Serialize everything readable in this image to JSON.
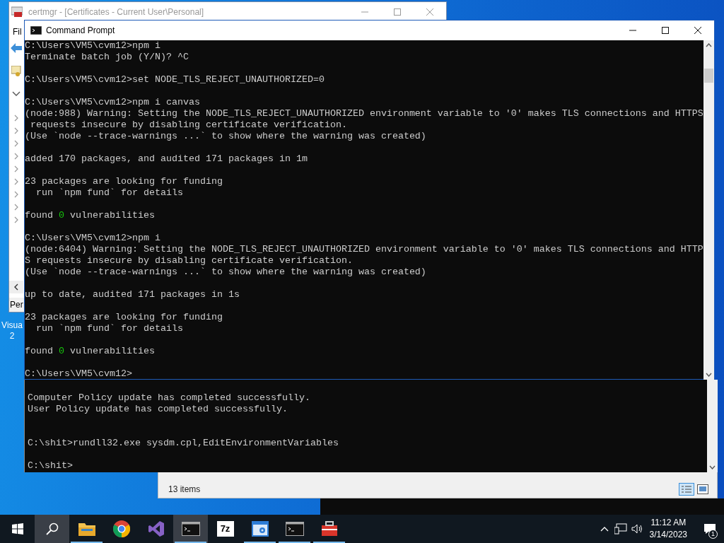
{
  "desktop": {
    "icon_label": "Visua\n2"
  },
  "certmgr": {
    "title": "certmgr - [Certificates - Current User\\Personal]",
    "menu_label": "Fil",
    "tab_label": "Per",
    "tree_nodes": [
      {
        "expanded": true
      },
      {
        "expanded": false
      },
      {
        "expanded": false
      },
      {
        "expanded": false
      },
      {
        "expanded": false
      },
      {
        "expanded": false
      },
      {
        "expanded": false
      },
      {
        "expanded": false
      },
      {
        "expanded": false
      },
      {
        "expanded": false
      }
    ]
  },
  "explorer": {
    "status": "13 items"
  },
  "command_prompt": {
    "title": "Command Prompt",
    "lines": [
      {
        "kind": "text",
        "text": "C:\\Users\\VM5\\cvm12>npm i"
      },
      {
        "kind": "text",
        "text": "Terminate batch job (Y/N)? ^C"
      },
      {
        "kind": "blank"
      },
      {
        "kind": "text",
        "text": "C:\\Users\\VM5\\cvm12>set NODE_TLS_REJECT_UNAUTHORIZED=0"
      },
      {
        "kind": "blank"
      },
      {
        "kind": "text",
        "text": "C:\\Users\\VM5\\cvm12>npm i canvas"
      },
      {
        "kind": "text",
        "text": "(node:988) Warning: Setting the NODE_TLS_REJECT_UNAUTHORIZED environment variable to '0' makes TLS connections and HTTPS"
      },
      {
        "kind": "text",
        "text": " requests insecure by disabling certificate verification."
      },
      {
        "kind": "text",
        "text": "(Use `node --trace-warnings ...` to show where the warning was created)"
      },
      {
        "kind": "blank"
      },
      {
        "kind": "text",
        "text": "added 170 packages, and audited 171 packages in 1m"
      },
      {
        "kind": "blank"
      },
      {
        "kind": "text",
        "text": "23 packages are looking for funding"
      },
      {
        "kind": "text",
        "text": "  run `npm fund` for details"
      },
      {
        "kind": "blank"
      },
      {
        "kind": "parts",
        "parts": [
          {
            "text": "found ",
            "color": "#cccccc"
          },
          {
            "text": "0",
            "color": "#16c60c"
          },
          {
            "text": " vulnerabilities",
            "color": "#cccccc"
          }
        ]
      },
      {
        "kind": "blank"
      },
      {
        "kind": "text",
        "text": "C:\\Users\\VM5\\cvm12>npm i"
      },
      {
        "kind": "text",
        "text": "(node:6404) Warning: Setting the NODE_TLS_REJECT_UNAUTHORIZED environment variable to '0' makes TLS connections and HTTP"
      },
      {
        "kind": "text",
        "text": "S requests insecure by disabling certificate verification."
      },
      {
        "kind": "text",
        "text": "(Use `node --trace-warnings ...` to show where the warning was created)"
      },
      {
        "kind": "blank"
      },
      {
        "kind": "text",
        "text": "up to date, audited 171 packages in 1s"
      },
      {
        "kind": "blank"
      },
      {
        "kind": "text",
        "text": "23 packages are looking for funding"
      },
      {
        "kind": "text",
        "text": "  run `npm fund` for details"
      },
      {
        "kind": "blank"
      },
      {
        "kind": "parts",
        "parts": [
          {
            "text": "found ",
            "color": "#cccccc"
          },
          {
            "text": "0",
            "color": "#16c60c"
          },
          {
            "text": " vulnerabilities",
            "color": "#cccccc"
          }
        ]
      },
      {
        "kind": "blank"
      },
      {
        "kind": "text",
        "text": "C:\\Users\\VM5\\cvm12>"
      }
    ]
  },
  "second_console": {
    "lines": [
      {
        "kind": "blank"
      },
      {
        "kind": "text",
        "text": "Computer Policy update has completed successfully."
      },
      {
        "kind": "text",
        "text": "User Policy update has completed successfully."
      },
      {
        "kind": "blank"
      },
      {
        "kind": "blank"
      },
      {
        "kind": "text",
        "text": "C:\\shit>rundll32.exe sysdm.cpl,EditEnvironmentVariables"
      },
      {
        "kind": "blank"
      },
      {
        "kind": "text",
        "text": "C:\\shit>"
      }
    ]
  },
  "taskbar": {
    "items": [
      {
        "kind": "start",
        "selected": false,
        "running": false
      },
      {
        "kind": "search",
        "selected": true,
        "running": false
      },
      {
        "kind": "folder",
        "selected": false,
        "running": true
      },
      {
        "kind": "browser",
        "selected": false,
        "running": false
      },
      {
        "kind": "ide",
        "selected": false,
        "running": false
      },
      {
        "kind": "terminal",
        "selected": true,
        "running": true
      },
      {
        "kind": "archive",
        "label": "7z",
        "selected": false,
        "running": false
      },
      {
        "kind": "settings",
        "selected": false,
        "running": true
      },
      {
        "kind": "terminal",
        "selected": false,
        "running": true
      },
      {
        "kind": "toolbox",
        "selected": false,
        "running": true
      }
    ],
    "time": "11:12 AM",
    "date": "3/14/2023",
    "notification_count": "1"
  }
}
